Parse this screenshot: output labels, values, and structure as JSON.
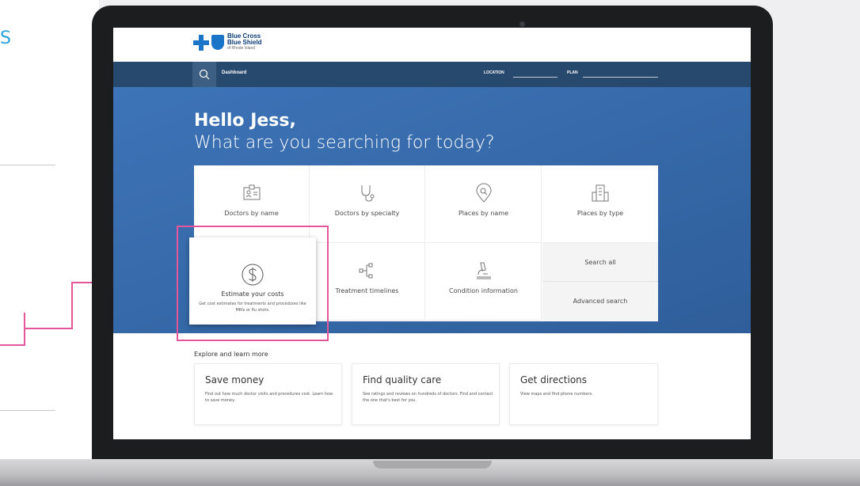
{
  "page": {
    "left_letter": "S"
  },
  "logo": {
    "line1": "Blue Cross",
    "line2": "Blue Shield",
    "line3": "of Rhode Island"
  },
  "nav": {
    "dashboard": "Dashboard",
    "location": "LOCATION",
    "plan": "PLAN"
  },
  "hero": {
    "greeting": "Hello Jess,",
    "question": "What are you searching for today?"
  },
  "options": [
    {
      "label": "Doctors by name",
      "icon": "id-card-icon"
    },
    {
      "label": "Doctors by specialty",
      "icon": "stethoscope-icon"
    },
    {
      "label": "Places by name",
      "icon": "map-pin-search-icon"
    },
    {
      "label": "Places by type",
      "icon": "building-icon"
    },
    {
      "label": "Treatment timelines",
      "icon": "timeline-icon"
    },
    {
      "label": "Condition information",
      "icon": "microscope-icon"
    }
  ],
  "side": {
    "search_all": "Search all",
    "advanced": "Advanced search"
  },
  "estimate": {
    "title": "Estimate your costs",
    "subtitle": "Get cost estimates for treatments and procedures like MRIs or flu shots.",
    "icon": "dollar-icon"
  },
  "explore": {
    "heading": "Explore and learn more",
    "cards": [
      {
        "title": "Save money",
        "text": "Find out how much doctor visits and procedures cost. Learn how to save money."
      },
      {
        "title": "Find quality care",
        "text": "See ratings and reviews on hundreds of doctors. Find and contact the one that's best for you."
      },
      {
        "title": "Get directions",
        "text": "View maps and find phone numbers."
      }
    ]
  },
  "colors": {
    "navbar": "#27496d",
    "hero": "#2f5e9a",
    "accent": "#e4569a",
    "brand": "#1a75c8"
  }
}
